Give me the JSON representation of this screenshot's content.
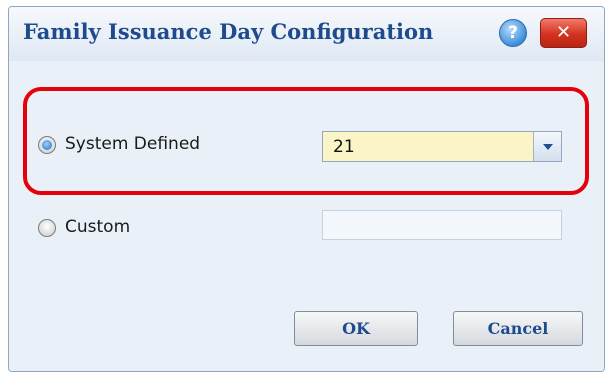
{
  "dialog": {
    "title": "Family Issuance Day Configuration",
    "help_label": "?",
    "close_label": "✕"
  },
  "options": {
    "system_defined": {
      "label": "System Defined",
      "selected": true,
      "value": "21"
    },
    "custom": {
      "label": "Custom",
      "selected": false,
      "value": ""
    }
  },
  "buttons": {
    "ok_label": "OK",
    "cancel_label": "Cancel"
  },
  "colors": {
    "title": "#1e4b8c",
    "highlight": "#e5000a",
    "dropdown_bg": "#fbf4c7",
    "close_button": "#d3321f"
  }
}
